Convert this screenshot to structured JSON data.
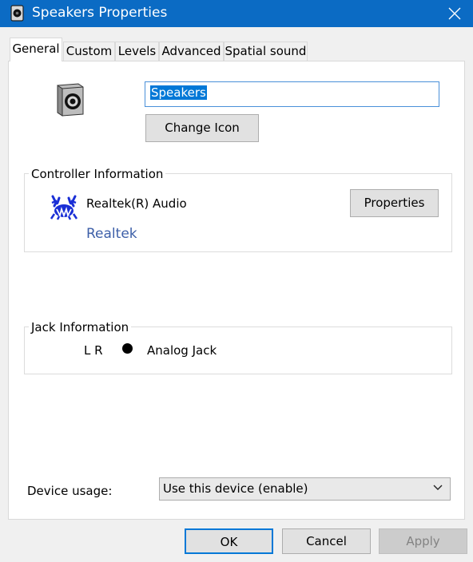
{
  "window": {
    "title": "Speakers Properties",
    "accent": "#0b6bc4"
  },
  "tabs": [
    {
      "label": "General",
      "active": true
    },
    {
      "label": "Custom"
    },
    {
      "label": "Levels"
    },
    {
      "label": "Advanced"
    },
    {
      "label": "Spatial sound"
    }
  ],
  "general": {
    "device_name": "Speakers",
    "change_icon_label": "Change Icon"
  },
  "controller": {
    "group_label": "Controller Information",
    "name": "Realtek(R) Audio",
    "vendor_link": "Realtek",
    "properties_label": "Properties"
  },
  "jack": {
    "group_label": "Jack Information",
    "channels": "L R",
    "type": "Analog Jack"
  },
  "device_usage": {
    "label": "Device usage:",
    "selected": "Use this device (enable)"
  },
  "footer": {
    "ok": "OK",
    "cancel": "Cancel",
    "apply": "Apply"
  }
}
